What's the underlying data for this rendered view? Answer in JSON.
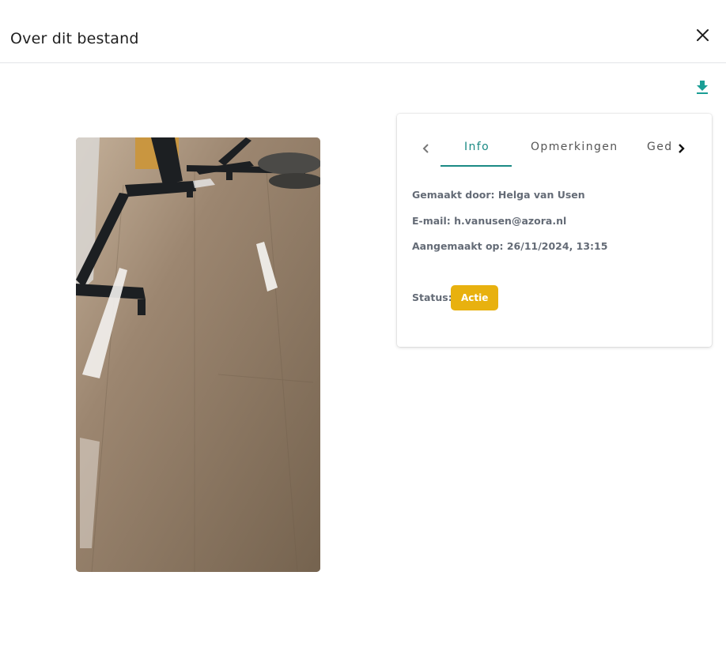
{
  "header": {
    "title": "Over dit bestand",
    "close_icon": "close-icon"
  },
  "toolbar": {
    "download_icon": "download-icon",
    "accent_color": "#1a9e95"
  },
  "photo": {
    "subject": "wood floor photo"
  },
  "tabs": {
    "items": [
      {
        "label": "Info",
        "active": true
      },
      {
        "label": "Opmerkingen",
        "active": false
      },
      {
        "label": "Gedeeld",
        "active": false
      }
    ],
    "prev_icon": "chevron-left-icon",
    "next_icon": "chevron-right-icon",
    "active_color": "#1a8a84"
  },
  "info": {
    "created_by": "Gemaakt door: Helga van Usen",
    "email": "E-mail: h.vanusen@azora.nl",
    "created_on": "Aangemaakt op: 26/11/2024, 13:15",
    "status_label": "Status:",
    "status_value": "Actie",
    "status_color": "#e8b10f"
  }
}
